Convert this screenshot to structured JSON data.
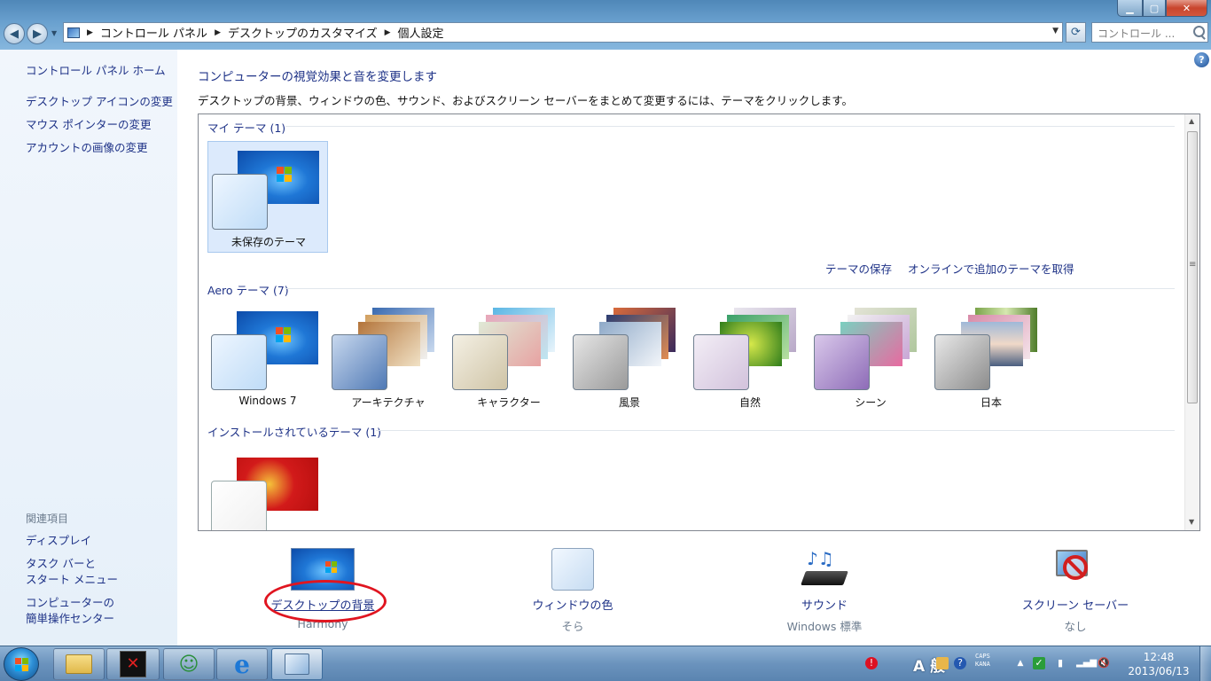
{
  "window": {
    "breadcrumbs": [
      "コントロール パネル",
      "デスクトップのカスタマイズ",
      "個人設定"
    ],
    "search_placeholder": "コントロール ..."
  },
  "sidebar": {
    "home_link": "コントロール パネル ホーム",
    "links": [
      "デスクトップ アイコンの変更",
      "マウス ポインターの変更",
      "アカウントの画像の変更"
    ],
    "related_heading": "関連項目",
    "related_links": [
      "ディスプレイ",
      "タスク バーと\nスタート メニュー",
      "コンピューターの\n簡単操作センター"
    ]
  },
  "main": {
    "title": "コンピューターの視覚効果と音を変更します",
    "description": "デスクトップの背景、ウィンドウの色、サウンド、およびスクリーン セーバーをまとめて変更するには、テーマをクリックします。",
    "groups": {
      "my_themes": {
        "heading": "マイ テーマ (1)",
        "themes": [
          {
            "name": "未保存のテーマ",
            "selected": true
          }
        ]
      },
      "save_link": "テーマの保存",
      "online_link": "オンラインで追加のテーマを取得",
      "aero": {
        "heading": "Aero テーマ (7)",
        "themes": [
          "Windows 7",
          "アーキテクチャ",
          "キャラクター",
          "風景",
          "自然",
          "シーン",
          "日本"
        ]
      },
      "installed": {
        "heading": "インストールされているテーマ (1)",
        "themes": [
          {
            "name": ""
          }
        ]
      }
    }
  },
  "settings": {
    "background": {
      "label": "デスクトップの背景",
      "value": "Harmony"
    },
    "color": {
      "label": "ウィンドウの色",
      "value": "そら"
    },
    "sound": {
      "label": "サウンド",
      "value": "Windows 標準"
    },
    "screensaver": {
      "label": "スクリーン セーバー",
      "value": "なし"
    }
  },
  "taskbar": {
    "ime": "A 般",
    "caps": "CAPS\nKANA",
    "time": "12:48",
    "date": "2013/06/13"
  },
  "colors": {
    "link": "#1e3287",
    "annotation": "#e01520",
    "selected_tile": "#dceafc"
  }
}
